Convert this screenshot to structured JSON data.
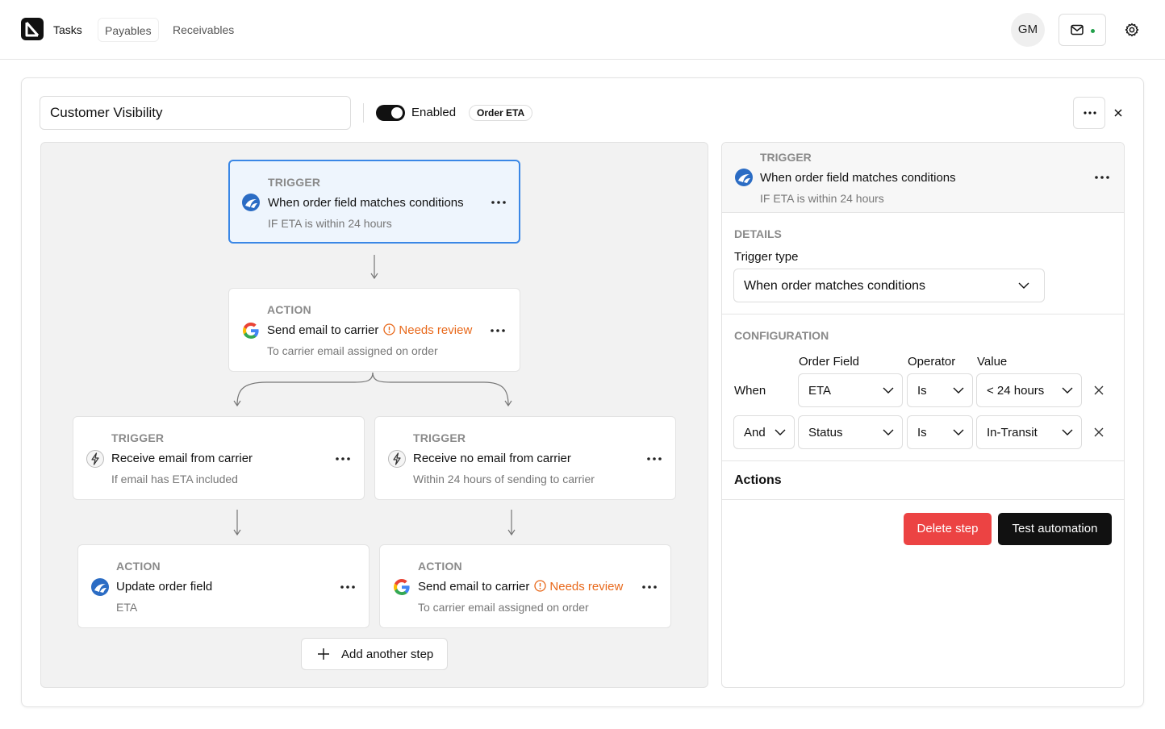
{
  "nav": {
    "tabs": [
      "Tasks",
      "Payables",
      "Receivables"
    ],
    "avatar_initials": "GM"
  },
  "automation": {
    "name": "Customer Visibility",
    "toggle_label": "Enabled",
    "badge": "Order ETA"
  },
  "flow": {
    "trigger1": {
      "kind": "TRIGGER",
      "title": "When order field matches conditions",
      "sub": "IF ETA is within 24 hours",
      "icon": "carrier-logo-icon"
    },
    "action1": {
      "kind": "ACTION",
      "title": "Send email to carrier",
      "review": "Needs review",
      "sub": "To carrier email assigned on order",
      "icon": "google-icon"
    },
    "trigger2": {
      "kind": "TRIGGER",
      "title": "Receive email from carrier",
      "sub": "If email has ETA included",
      "icon": "lightning-icon"
    },
    "trigger3": {
      "kind": "TRIGGER",
      "title": "Receive no email from carrier",
      "sub": "Within 24 hours of sending to carrier",
      "icon": "lightning-icon"
    },
    "action2": {
      "kind": "ACTION",
      "title": "Update order field",
      "sub": "ETA",
      "icon": "carrier-logo-icon"
    },
    "action3": {
      "kind": "ACTION",
      "title": "Send email to carrier",
      "review": "Needs review",
      "sub": "To carrier email assigned on order",
      "icon": "google-icon"
    },
    "add_step": "Add another step"
  },
  "sidebar": {
    "header": {
      "kind": "TRIGGER",
      "title": "When order field matches conditions",
      "sub": "IF ETA is within 24 hours"
    },
    "details_label": "DETAILS",
    "trigger_type_label": "Trigger type",
    "trigger_type_value": "When order matches conditions",
    "config_label": "CONFIGURATION",
    "columns": [
      "Order Field",
      "Operator",
      "Value"
    ],
    "rows": [
      {
        "connector": "When",
        "field": "ETA",
        "operator": "Is",
        "value": "< 24 hours"
      },
      {
        "connector": "And",
        "field": "Status",
        "operator": "Is",
        "value": "In-Transit"
      }
    ],
    "actions_label": "Actions",
    "delete_label": "Delete step",
    "test_label": "Test automation"
  }
}
